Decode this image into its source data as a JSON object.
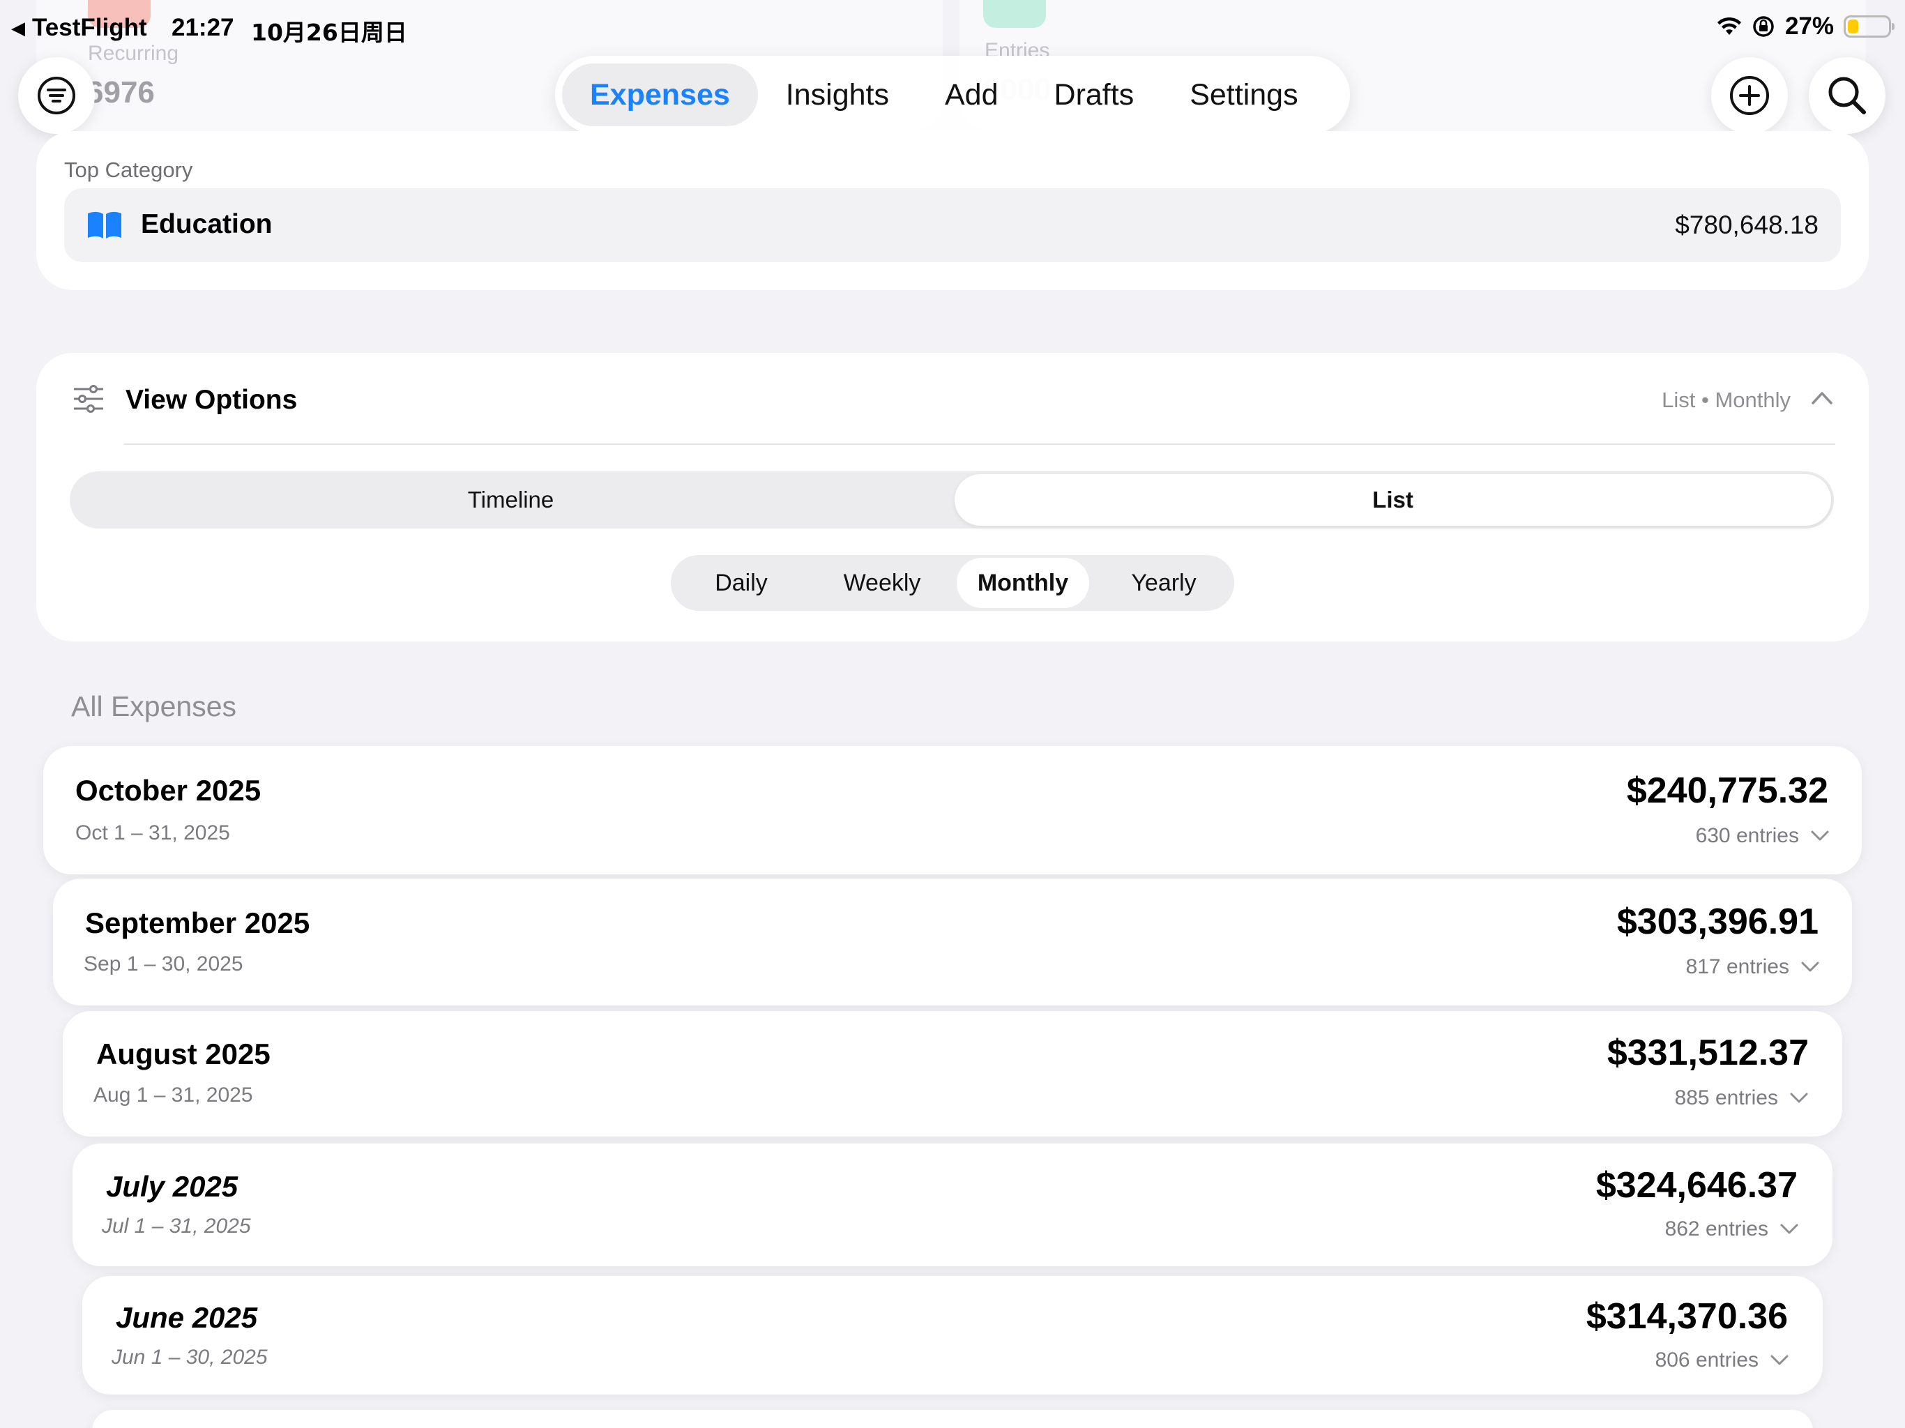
{
  "status_bar": {
    "back_app": "TestFlight",
    "time": "21:27",
    "date": "10月26日周日",
    "battery": "27%",
    "battery_level": 0.27
  },
  "ghost_cards": {
    "left_label": "Recurring",
    "left_value": "6976",
    "right_label": "Entries",
    "right_value": "0000"
  },
  "tabs": [
    {
      "label": "Expenses",
      "active": true
    },
    {
      "label": "Insights",
      "active": false
    },
    {
      "label": "Add",
      "active": false
    },
    {
      "label": "Drafts",
      "active": false
    },
    {
      "label": "Settings",
      "active": false
    }
  ],
  "top_category": {
    "label": "Top Category",
    "name": "Education",
    "amount": "$780,648.18"
  },
  "view_options": {
    "title": "View Options",
    "summary": "List • Monthly",
    "layout_options": [
      "Timeline",
      "List"
    ],
    "layout_selected": "List",
    "period_options": [
      "Daily",
      "Weekly",
      "Monthly",
      "Yearly"
    ],
    "period_selected": "Monthly"
  },
  "list": {
    "section_title": "All Expenses",
    "months": [
      {
        "title": "October 2025",
        "range": "Oct 1 – 31, 2025",
        "amount": "$240,775.32",
        "entries": "630 entries"
      },
      {
        "title": "September 2025",
        "range": "Sep 1 – 30, 2025",
        "amount": "$303,396.91",
        "entries": "817 entries"
      },
      {
        "title": "August 2025",
        "range": "Aug 1 – 31, 2025",
        "amount": "$331,512.37",
        "entries": "885 entries"
      },
      {
        "title": "July 2025",
        "range": "Jul 1 – 31, 2025",
        "amount": "$324,646.37",
        "entries": "862 entries"
      },
      {
        "title": "June 2025",
        "range": "Jun 1 – 30, 2025",
        "amount": "$314,370.36",
        "entries": "806 entries"
      }
    ]
  },
  "colors": {
    "accent": "#1a82ff",
    "background": "#f2f2f7",
    "education_icon": "#1a82ff"
  },
  "icons": {
    "filter": "filter-icon",
    "add": "plus-circle-icon",
    "search": "search-icon",
    "education": "book-icon",
    "view_options": "sliders-icon",
    "collapse": "chevron-up-icon",
    "expand": "chevron-down-icon"
  }
}
